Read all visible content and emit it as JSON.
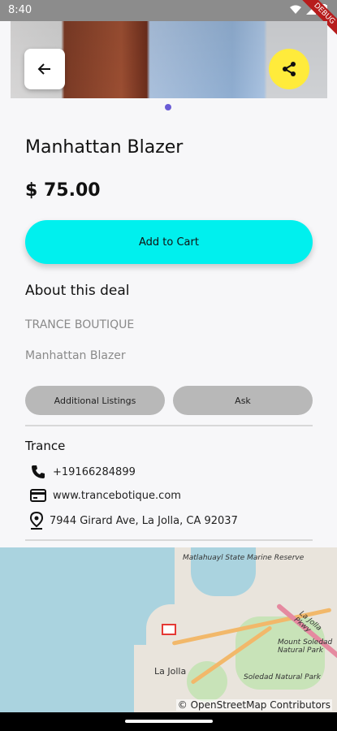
{
  "status_bar": {
    "time": "8:40",
    "debug_label": "DEBUG"
  },
  "product": {
    "title": "Manhattan Blazer",
    "price": "$ 75.00",
    "add_to_cart_label": "Add to Cart"
  },
  "about": {
    "heading": "About this deal",
    "boutique": "TRANCE BOUTIQUE",
    "item_name": "Manhattan Blazer",
    "additional_listings_label": "Additional Listings",
    "ask_label": "Ask"
  },
  "store": {
    "name": "Trance",
    "phone": "+19166284899",
    "website": "www.trancebotique.com",
    "address": "7944 Girard Ave, La Jolla, CA 92037"
  },
  "map": {
    "labels": [
      "Matlahuayl State Marine Reserve",
      "La Jolla",
      "Mount Soledad Natural Park",
      "Soledad Natural Park",
      "La Jolla Pkwy"
    ],
    "attribution": "© OpenStreetMap Contributors"
  },
  "icons": {
    "back": "arrow-left-icon",
    "share": "share-icon",
    "phone": "phone-icon",
    "web": "web-icon",
    "location": "location-pin-icon"
  },
  "colors": {
    "accent": "#00f0ee",
    "share_button": "#ffeb3b",
    "pill_button": "#b8b8b8",
    "page_indicator": "#6a5cd6"
  }
}
